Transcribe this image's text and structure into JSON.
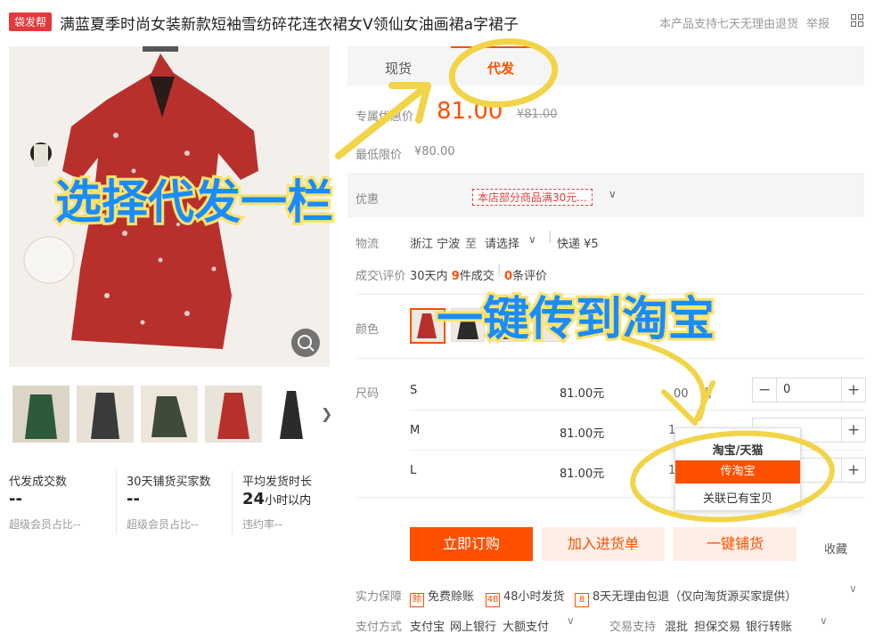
{
  "header": {
    "badge": "袋发帮",
    "title": "满蓝夏季时尚女装新款短袖雪纺碎花连衣裙女V领仙女油画裙a字裙子",
    "return_policy": "本产品支持七天无理由退货",
    "report": "举报",
    "grid_icon": "qr-grid-icon"
  },
  "tabs": [
    {
      "label": "现货"
    },
    {
      "label": "代发",
      "active": true
    }
  ],
  "price": {
    "label": "专属优惠价",
    "value": "81.00",
    "old_value": "¥81.00",
    "min_label": "最低限价",
    "min_value": "¥80.00"
  },
  "promo": {
    "label": "优惠",
    "coupon": "本店部分商品满30元..."
  },
  "logistics": {
    "label": "物流",
    "origin": "浙江 宁波",
    "to": "至",
    "select": "请选择",
    "express": "快递 ¥5"
  },
  "deals": {
    "label": "成交\\评价",
    "days": "30天内",
    "count": "9",
    "count_unit": "件成交",
    "reviews": "0",
    "reviews_unit": "条评价"
  },
  "color_label": "颜色",
  "size_label": "尺码",
  "sizes": [
    {
      "name": "S",
      "price": "81.00元",
      "stock": "00",
      "stock_suffix": "售",
      "qty": "0"
    },
    {
      "name": "M",
      "price": "81.00元",
      "stock": "1"
    },
    {
      "name": "L",
      "price": "81.00元",
      "stock": "1"
    }
  ],
  "dropdown": {
    "header": "淘宝/天猫",
    "option_active": "传淘宝",
    "option_2": "关联已有宝贝"
  },
  "buttons": {
    "order": "立即订购",
    "cart": "加入进货单",
    "one_click": "一键铺货",
    "fav": "收藏"
  },
  "guarantee": {
    "label": "实力保障",
    "items": [
      "免费赊账",
      "48小时发货",
      "8天无理由包退（仅向淘货源买家提供）"
    ]
  },
  "payment": {
    "label": "支付方式",
    "methods": [
      "支付宝",
      "网上银行",
      "大额支付"
    ],
    "trade_label": "交易支持",
    "trade": [
      "混批",
      "担保交易",
      "银行转账"
    ]
  },
  "stats": [
    {
      "label": "代发成交数",
      "value": "--",
      "sub": "超级会员占比--"
    },
    {
      "label": "30天铺货买家数",
      "value": "--",
      "sub": "超级会员占比--"
    },
    {
      "label": "平均发货时长",
      "value": "24",
      "unit": "小时以内",
      "sub": "违约率--"
    }
  ],
  "annotations": {
    "select_tab": "选择代发一栏",
    "one_click_taobao": "一键传到淘宝"
  },
  "colors": {
    "accent": "#ff5000",
    "annotation_fill": "#1a8cff",
    "annotation_stroke": "#ffe36b"
  }
}
